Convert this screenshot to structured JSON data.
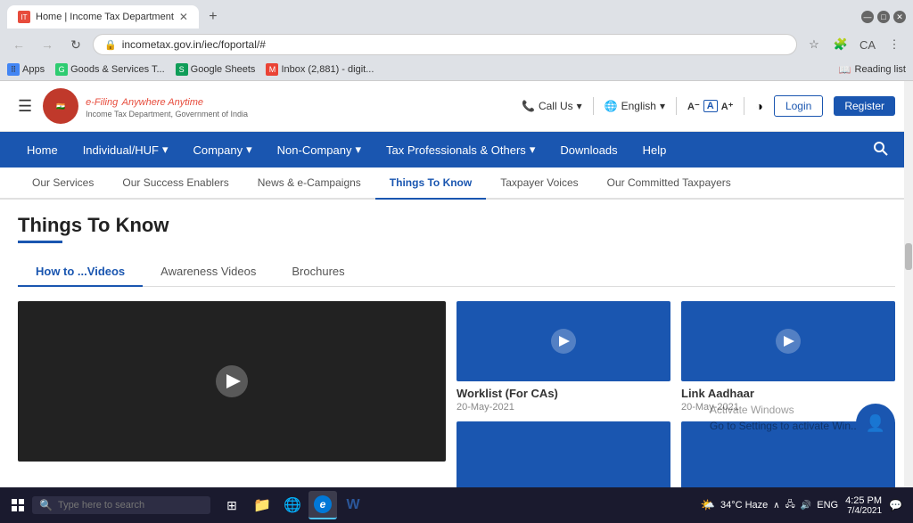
{
  "browser": {
    "tab_title": "Home | Income Tax Department",
    "url": "incometax.gov.in/iec/foportal/#",
    "bookmarks": [
      {
        "label": "Apps",
        "icon": "grid"
      },
      {
        "label": "Goods & Services T...",
        "icon": "green"
      },
      {
        "label": "Google Sheets",
        "icon": "sheets"
      },
      {
        "label": "Inbox (2,881) - digit...",
        "icon": "gmail"
      }
    ],
    "reading_list_label": "Reading list"
  },
  "header": {
    "menu_icon": "☰",
    "logo_efiling": "e-Filing",
    "logo_tagline": "Anywhere Anytime",
    "logo_subtitle": "Income Tax Department, Government of India",
    "call_us": "Call Us",
    "language": "English",
    "login_label": "Login",
    "register_label": "Register"
  },
  "main_nav": {
    "items": [
      {
        "label": "Home",
        "active": false
      },
      {
        "label": "Individual/HUF",
        "dropdown": true
      },
      {
        "label": "Company",
        "dropdown": true
      },
      {
        "label": "Non-Company",
        "dropdown": true
      },
      {
        "label": "Tax Professionals & Others",
        "dropdown": true
      },
      {
        "label": "Downloads"
      },
      {
        "label": "Help"
      }
    ]
  },
  "sub_nav": {
    "items": [
      {
        "label": "Our Services"
      },
      {
        "label": "Our Success Enablers"
      },
      {
        "label": "News & e-Campaigns"
      },
      {
        "label": "Things To Know",
        "active": true
      },
      {
        "label": "Taxpayer Voices"
      },
      {
        "label": "Our Committed Taxpayers"
      }
    ]
  },
  "page": {
    "title": "Things To Know",
    "tabs": [
      {
        "label": "How to ...Videos",
        "active": true
      },
      {
        "label": "Awareness Videos"
      },
      {
        "label": "Brochures"
      }
    ]
  },
  "videos": {
    "featured": {
      "type": "large"
    },
    "items": [
      {
        "title": "Worklist (For CAs)",
        "date": "20-May-2021"
      },
      {
        "title": "Link Aadhaar",
        "date": "20-May-2021"
      }
    ]
  },
  "watermark": {
    "line1": "Activate Windows",
    "line2": "Go to Settings to activate Win..."
  },
  "taskbar": {
    "search_placeholder": "Type here to search",
    "weather": "34°C Haze",
    "language": "ENG",
    "time": "4:25 PM",
    "date": "7/4/2021"
  }
}
